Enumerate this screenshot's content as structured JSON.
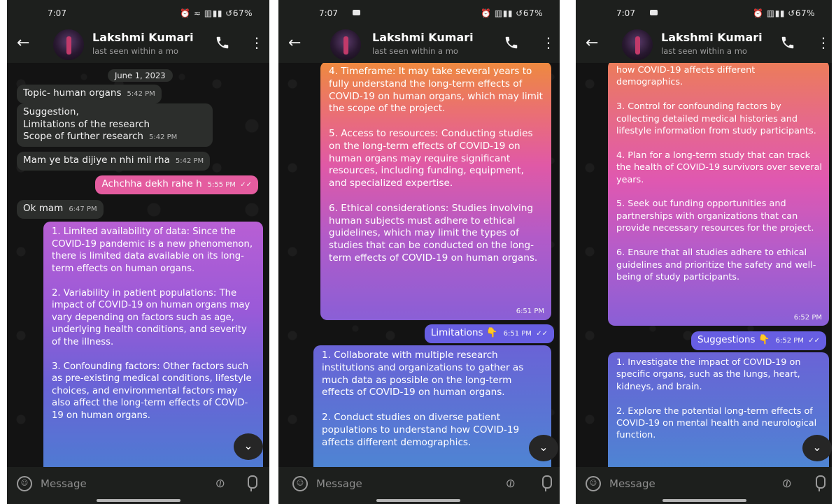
{
  "contact": {
    "name": "Lakshmi Kumari",
    "status": "last seen within a mo"
  },
  "input": {
    "placeholder": "Message"
  },
  "icons": {
    "back": "arrow-left-icon",
    "call": "phone-icon",
    "menu": "more-vert-icon",
    "emoji": "emoji-icon",
    "attach": "paperclip-icon",
    "mic": "microphone-icon",
    "scroll": "chevron-down-icon"
  },
  "colors": {
    "header": "#1d1f1d",
    "chat_bg": "#131313",
    "incoming": "#2c2e2c",
    "outgoing_pink": "#e45c9f",
    "gradient_top": "#f08a3c",
    "gradient_mid": "#e052a8",
    "gradient_bottom": "#3f86d6"
  },
  "screens": [
    {
      "status_time": "7:07",
      "status_icons": "⏰ ≈ ▥▮▮ ↺67%",
      "date_chip": "June 1, 2023",
      "messages": [
        {
          "text": "Topic- human organs",
          "time": "5:42 PM"
        },
        {
          "text": "Suggestion,\nLimitations of the research\nScope of further research",
          "time": "5:42 PM"
        },
        {
          "text": "Mam ye bta dijiye n nhi mil rha",
          "time": "5:42 PM"
        },
        {
          "text": "Achchha dekh rahe h",
          "time": "5:55 PM"
        },
        {
          "text": "Ok mam",
          "time": "6:47 PM"
        },
        {
          "text": "1. Limited availability of data: Since the COVID-19 pandemic is a new phenomenon, there is limited data available on its long-term effects on human organs.\n\n2. Variability in patient populations: The impact of COVID-19 on human organs may vary depending on factors such as age, underlying health conditions, and severity of the illness.\n\n3. Confounding factors: Other factors such as pre-existing medical conditions, lifestyle choices, and environmental factors may also affect the long-term effects of COVID-19 on human organs."
        }
      ]
    },
    {
      "status_time": "7:07",
      "status_icons": "⏰ ▥▮▮ ↺67%",
      "messages": [
        {
          "text": "4. Timeframe: It may take several years to fully understand the long-term effects of COVID-19 on human organs, which may limit the scope of the project.\n\n5. Access to resources: Conducting studies on the long-term effects of COVID-19 on human organs may require significant resources, including funding, equipment, and specialized expertise.\n\n6. Ethical considerations: Studies involving human subjects must adhere to ethical guidelines, which may limit the types of studies that can be conducted on the long-term effects of COVID-19 on human organs.",
          "time": "6:51 PM"
        },
        {
          "text": "Limitations 👇",
          "time": "6:51 PM"
        },
        {
          "text": "1. Collaborate with multiple research institutions and organizations to gather as much data as possible on the long-term effects of COVID-19 on human organs.\n\n2. Conduct studies on diverse patient populations to understand how COVID-19 affects different demographics."
        }
      ]
    },
    {
      "status_time": "7:07",
      "status_icons": "⏰ ▥▮▮ ↺67%",
      "messages": [
        {
          "text": "how COVID-19 affects different demographics.\n\n3. Control for confounding factors by collecting detailed medical histories and lifestyle information from study participants.\n\n4. Plan for a long-term study that can track the health of COVID-19 survivors over several years.\n\n5. Seek out funding opportunities and partnerships with organizations that can provide necessary resources for the project.\n\n6. Ensure that all studies adhere to ethical guidelines and prioritize the safety and well-being of study participants.",
          "time": "6:52 PM"
        },
        {
          "text": "Suggestions 👇",
          "time": "6:52 PM"
        },
        {
          "text": "1. Investigate the impact of COVID-19 on specific organs, such as the lungs, heart, kidneys, and brain.\n\n2. Explore the potential long-term effects of COVID-19 on mental health and neurological function."
        }
      ]
    }
  ]
}
